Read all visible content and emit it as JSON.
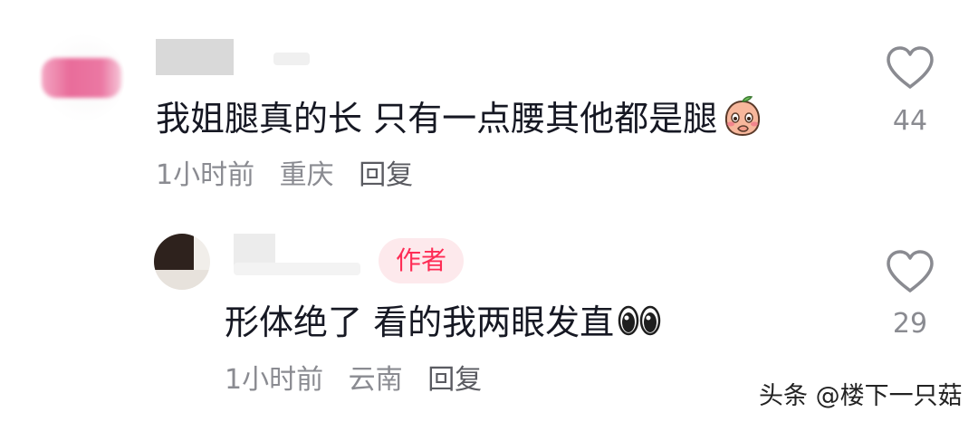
{
  "comments": [
    {
      "text": "我姐腿真的长 只有一点腰其他都是腿",
      "emoji": "peach-blush-emoji",
      "time": "1小时前",
      "location": "重庆",
      "reply_label": "回复",
      "likes": "44"
    },
    {
      "author_badge": "作者",
      "text": "形体绝了 看的我两眼发直",
      "emoji": "eyes-emoji",
      "time": "1小时前",
      "location": "云南",
      "reply_label": "回复",
      "likes": "29"
    }
  ],
  "watermark": "头条 @楼下一只菇",
  "colors": {
    "badge_text": "#fe2c55",
    "badge_bg": "#fde9ec",
    "meta_text": "#8a8b91",
    "heart_stroke": "#8a8b91"
  }
}
